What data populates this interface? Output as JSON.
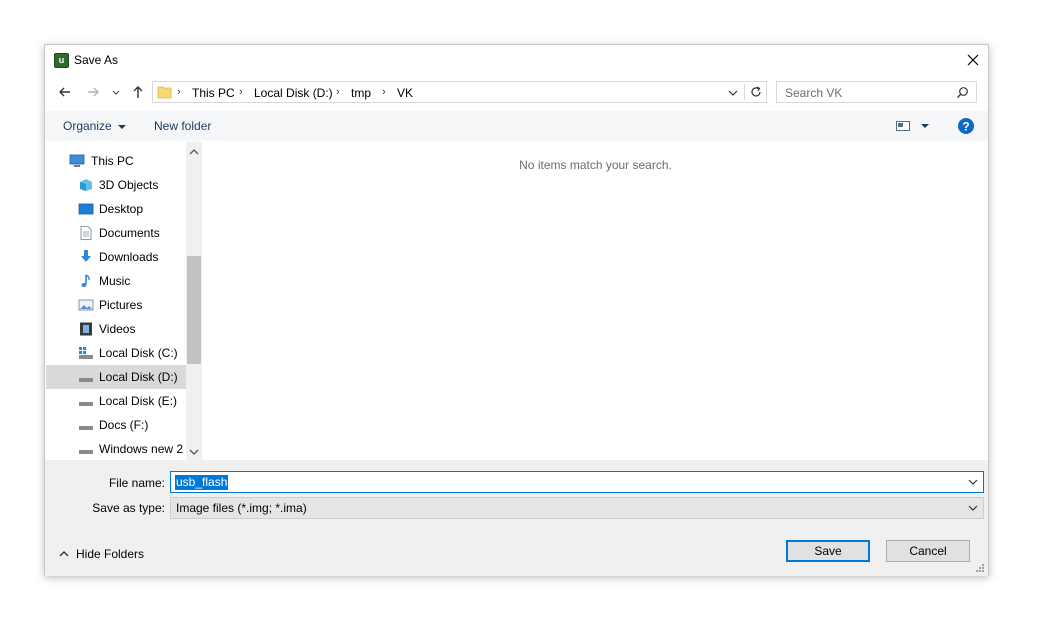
{
  "window": {
    "title": "Save As",
    "app_icon_letter": "u"
  },
  "address": {
    "crumbs": [
      "This PC",
      "Local Disk (D:)",
      "tmp",
      "VK"
    ]
  },
  "search": {
    "placeholder": "Search VK"
  },
  "toolbar": {
    "organize": "Organize",
    "new_folder": "New folder"
  },
  "nav": {
    "items": [
      {
        "label": "This PC",
        "icon": "computer-icon"
      },
      {
        "label": "3D Objects",
        "icon": "cube-icon"
      },
      {
        "label": "Desktop",
        "icon": "desktop-icon"
      },
      {
        "label": "Documents",
        "icon": "document-icon"
      },
      {
        "label": "Downloads",
        "icon": "download-arrow-icon"
      },
      {
        "label": "Music",
        "icon": "music-note-icon"
      },
      {
        "label": "Pictures",
        "icon": "picture-icon"
      },
      {
        "label": "Videos",
        "icon": "film-icon"
      },
      {
        "label": "Local Disk (C:)",
        "icon": "system-drive-icon"
      },
      {
        "label": "Local Disk (D:)",
        "icon": "drive-icon",
        "selected": true
      },
      {
        "label": "Local Disk (E:)",
        "icon": "drive-icon"
      },
      {
        "label": "Docs (F:)",
        "icon": "drive-icon"
      },
      {
        "label": "Windows new 2",
        "icon": "drive-icon"
      }
    ]
  },
  "content": {
    "empty_message": "No items match your search."
  },
  "form": {
    "file_name_label": "File name:",
    "file_name_value": "usb_flash",
    "save_type_label": "Save as type:",
    "save_type_value": "Image files (*.img; *.ima)"
  },
  "footer": {
    "hide_folders": "Hide Folders",
    "save": "Save",
    "cancel": "Cancel"
  },
  "colors": {
    "accent": "#0078d7",
    "link": "#1e395b",
    "selected_row": "#d9d9d9"
  }
}
